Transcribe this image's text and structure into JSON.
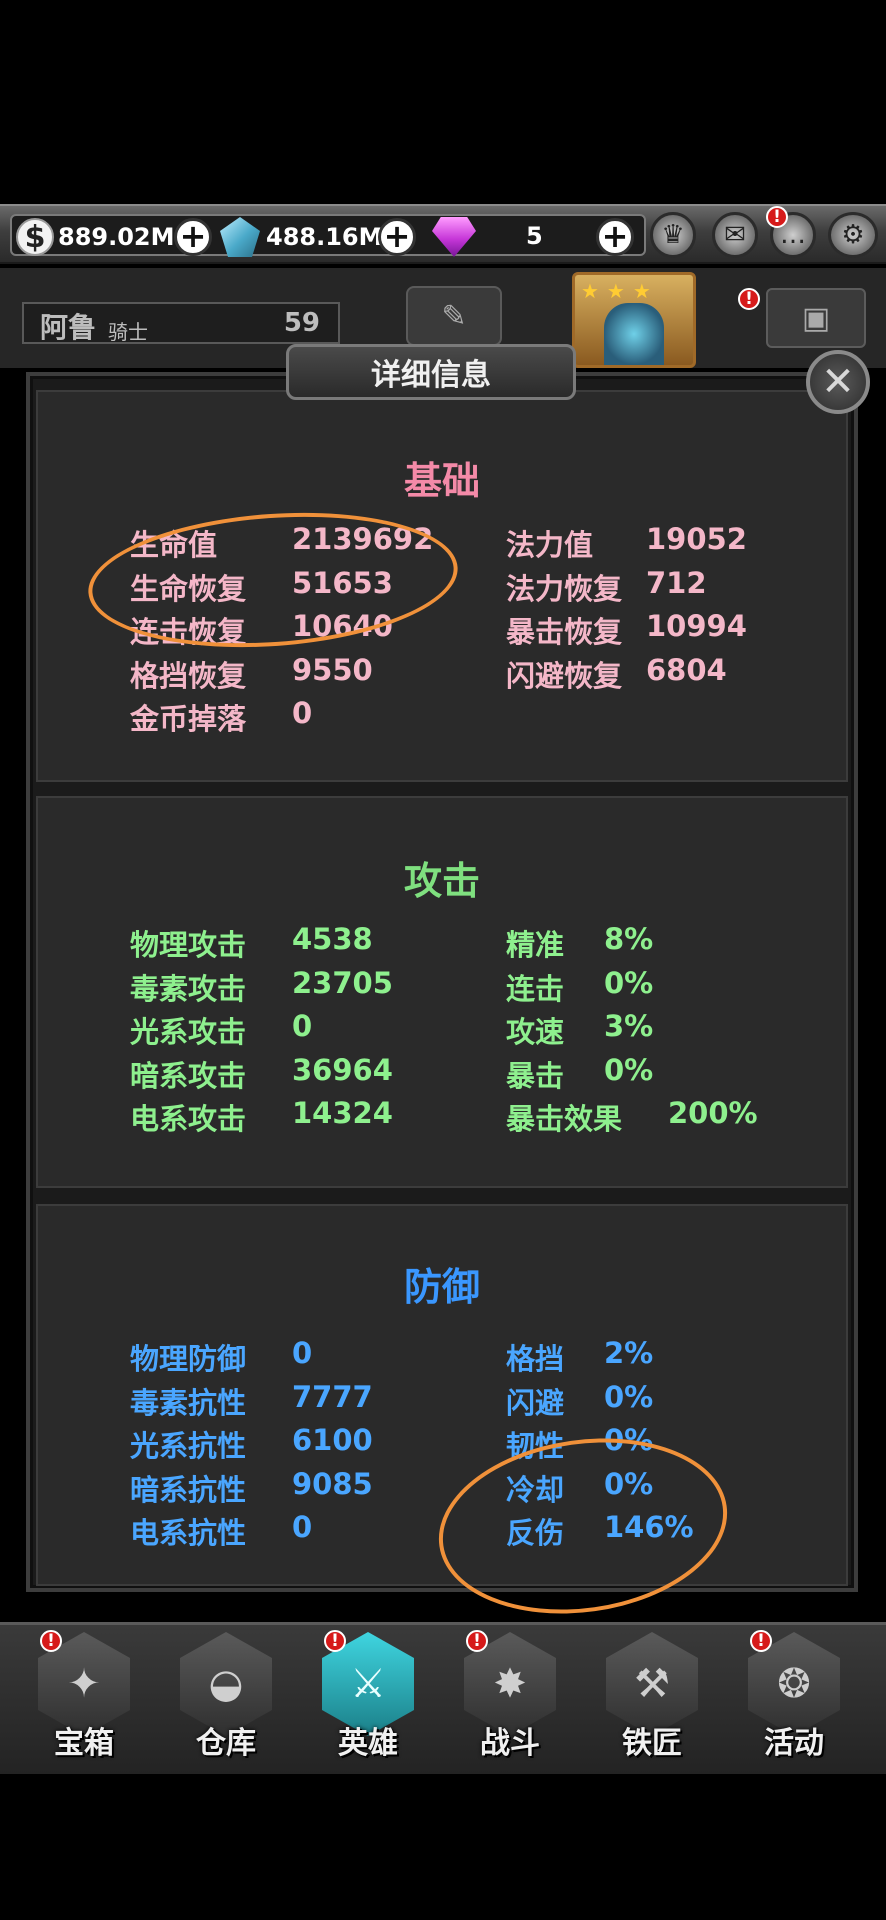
{
  "topbar": {
    "coins": {
      "icon": "coin-icon",
      "value": "889.02M"
    },
    "crystals": {
      "icon": "crystal-icon",
      "value": "488.16M"
    },
    "gems": {
      "icon": "gem-icon",
      "value": "5"
    },
    "plus": "+",
    "icons": [
      "trophy-icon",
      "mail-icon",
      "chat-icon",
      "gear-icon"
    ],
    "alert": "!"
  },
  "hero": {
    "name": "阿鲁",
    "class": "骑士",
    "level": "59"
  },
  "panel": {
    "title": "详细信息",
    "close": "✕"
  },
  "sections": {
    "basic": {
      "title": "基础",
      "color": "#f4b7c8",
      "left": [
        {
          "label": "生命值",
          "value": "2139692"
        },
        {
          "label": "生命恢复",
          "value": "51653"
        },
        {
          "label": "连击恢复",
          "value": "10640"
        },
        {
          "label": "格挡恢复",
          "value": "9550"
        },
        {
          "label": "金币掉落",
          "value": "0"
        }
      ],
      "right": [
        {
          "label": "法力值",
          "value": "19052"
        },
        {
          "label": "法力恢复",
          "value": "712"
        },
        {
          "label": "暴击恢复",
          "value": "10994"
        },
        {
          "label": "闪避恢复",
          "value": "6804"
        }
      ]
    },
    "attack": {
      "title": "攻击",
      "color": "#8ef08e",
      "left": [
        {
          "label": "物理攻击",
          "value": "4538"
        },
        {
          "label": "毒素攻击",
          "value": "23705"
        },
        {
          "label": "光系攻击",
          "value": "0"
        },
        {
          "label": "暗系攻击",
          "value": "36964"
        },
        {
          "label": "电系攻击",
          "value": "14324"
        }
      ],
      "right": [
        {
          "label": "精准",
          "value": "8%"
        },
        {
          "label": "连击",
          "value": "0%"
        },
        {
          "label": "攻速",
          "value": "3%"
        },
        {
          "label": "暴击",
          "value": "0%"
        },
        {
          "label": "暴击效果",
          "value": "200%"
        }
      ]
    },
    "defense": {
      "title": "防御",
      "color": "#4aa6ff",
      "left": [
        {
          "label": "物理防御",
          "value": "0"
        },
        {
          "label": "毒素抗性",
          "value": "7777"
        },
        {
          "label": "光系抗性",
          "value": "6100"
        },
        {
          "label": "暗系抗性",
          "value": "9085"
        },
        {
          "label": "电系抗性",
          "value": "0"
        }
      ],
      "right": [
        {
          "label": "格挡",
          "value": "2%"
        },
        {
          "label": "闪避",
          "value": "0%"
        },
        {
          "label": "韧性",
          "value": "0%"
        },
        {
          "label": "冷却",
          "value": "0%"
        },
        {
          "label": "反伤",
          "value": "146%"
        }
      ]
    }
  },
  "nav": {
    "items": [
      {
        "label": "宝箱",
        "icon": "chest-icon",
        "alert": true,
        "active": false
      },
      {
        "label": "仓库",
        "icon": "backpack-icon",
        "alert": false,
        "active": false
      },
      {
        "label": "英雄",
        "icon": "sword-icon",
        "alert": true,
        "active": true
      },
      {
        "label": "战斗",
        "icon": "battle-icon",
        "alert": true,
        "active": false
      },
      {
        "label": "铁匠",
        "icon": "anvil-icon",
        "alert": false,
        "active": false
      },
      {
        "label": "活动",
        "icon": "vortex-icon",
        "alert": true,
        "active": false
      }
    ]
  }
}
